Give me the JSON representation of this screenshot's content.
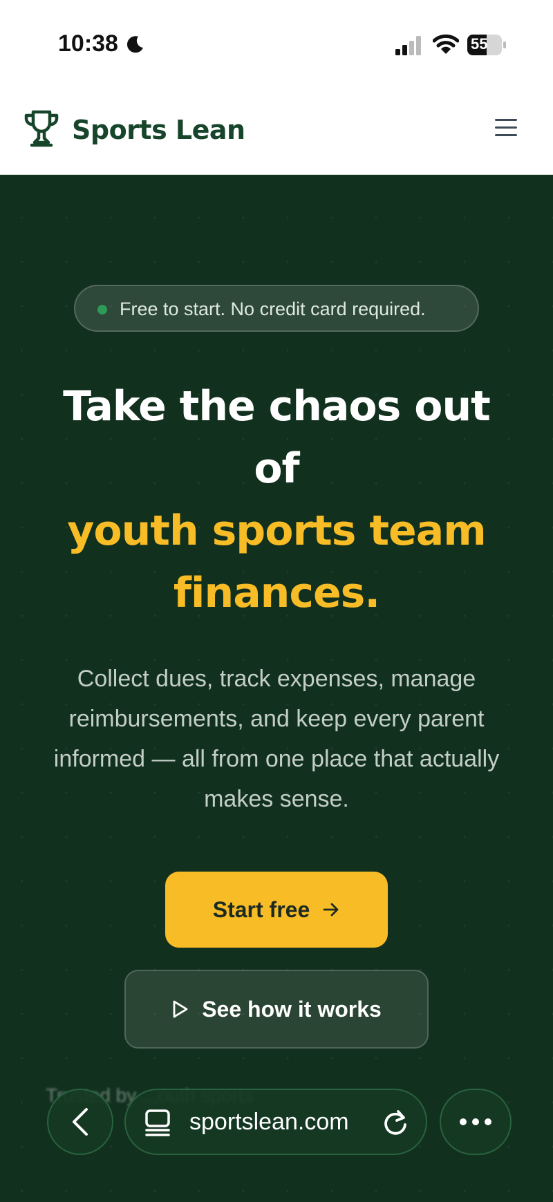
{
  "status_bar": {
    "time": "10:38",
    "battery": "55"
  },
  "nav": {
    "brand": "Sports Lean"
  },
  "hero": {
    "badge": "Free to start. No credit card required.",
    "headline_white_1": "Take the chaos out",
    "headline_white_2": "of",
    "headline_gold_1": "youth sports team",
    "headline_gold_2": "finances.",
    "subtext": "Collect dues, track expenses, manage reimbursements, and keep every parent informed — all from one place that actually makes sense.",
    "primary_cta": "Start free",
    "secondary_cta": "See how it works",
    "trusted_text": "Trusted by ...outh sports"
  },
  "browser": {
    "url": "sportslean.com"
  },
  "colors": {
    "dark_green": "#12301e",
    "brand_green": "#17452b",
    "gold": "#f8bd26",
    "badge_dot": "#2e9a58"
  },
  "icons": [
    "moon-icon",
    "signal-icon",
    "wifi-icon",
    "battery-icon",
    "trophy-icon",
    "menu-icon",
    "arrow-right-icon",
    "play-icon",
    "back-icon",
    "tabs-icon",
    "reload-icon",
    "more-icon"
  ]
}
